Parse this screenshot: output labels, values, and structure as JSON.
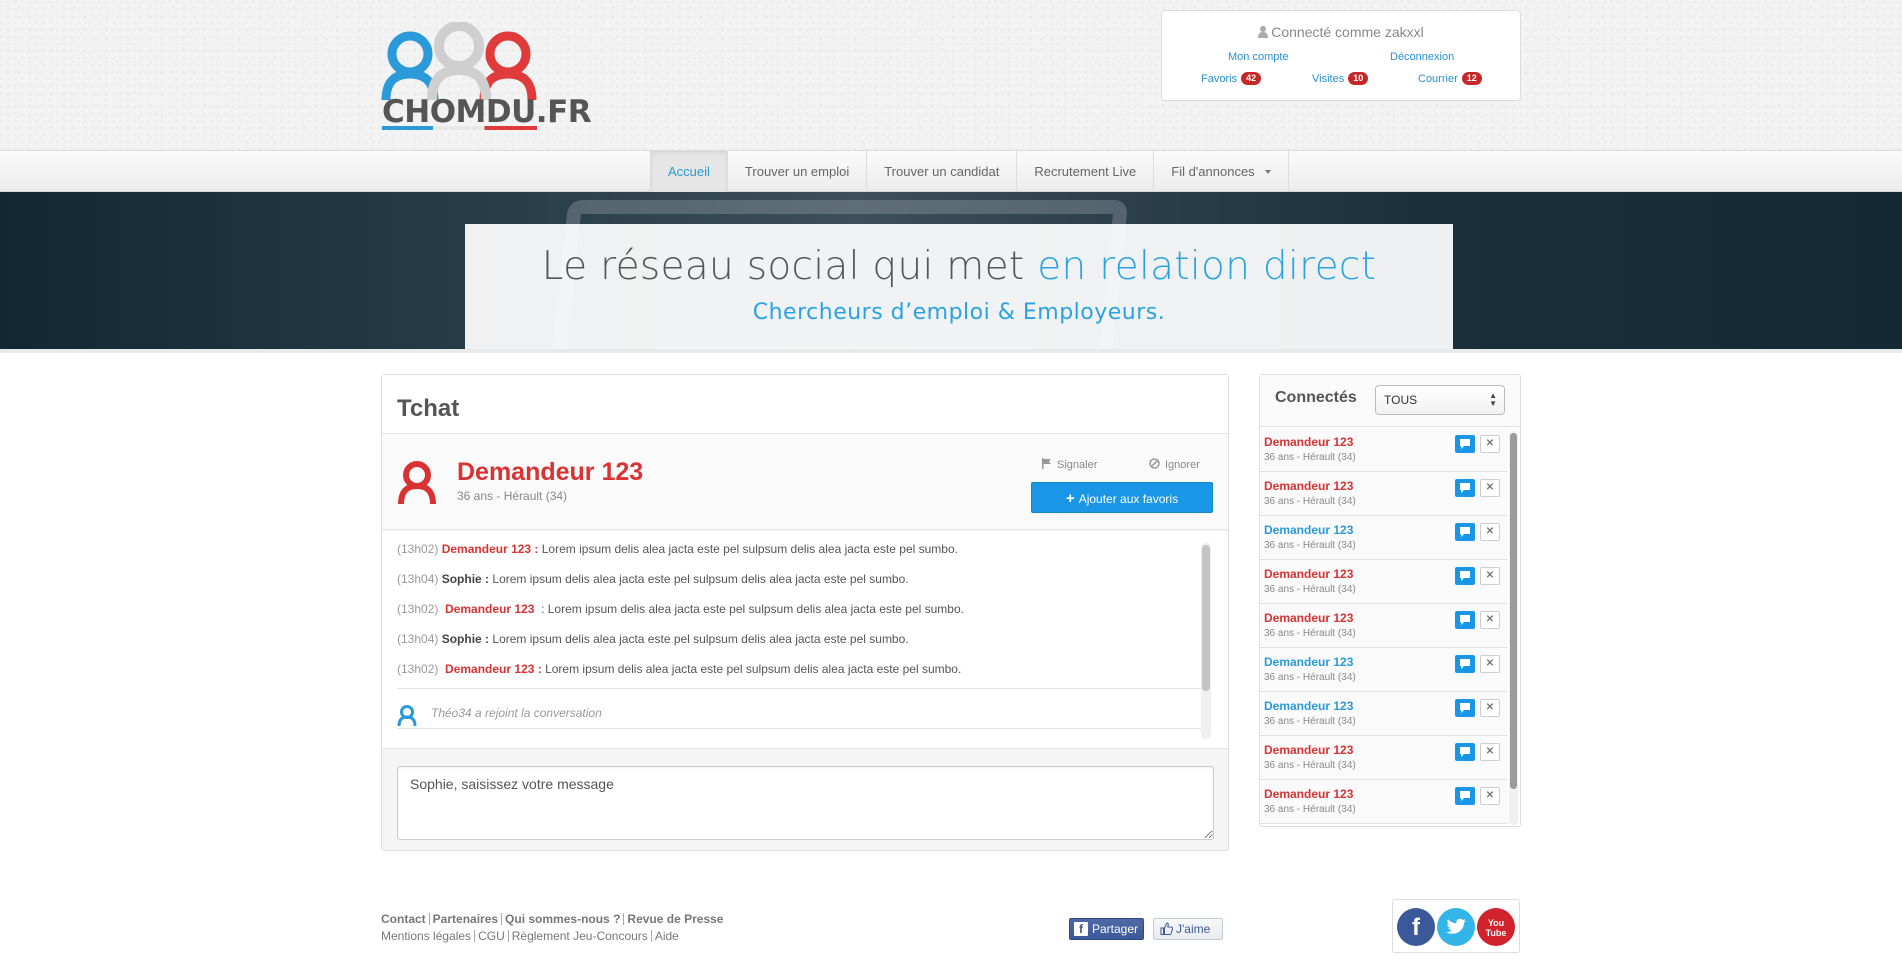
{
  "brand": {
    "logo_text": "CHOMDU.FR",
    "colors": {
      "blue": "#2a9ad8",
      "red": "#d83232",
      "grey": "#cfcfcf"
    }
  },
  "user_box": {
    "connected_label": "Connecté comme zakxxl",
    "user_icon": "user-icon",
    "account_link": "Mon compte",
    "logout_link": "Déconnexion",
    "favorites_label": "Favoris",
    "favorites_count": "42",
    "visits_label": "Visites",
    "visits_count": "10",
    "mail_label": "Courrier",
    "mail_count": "12"
  },
  "nav": {
    "items": [
      {
        "label": "Accueil",
        "active": true
      },
      {
        "label": "Trouver un emploi"
      },
      {
        "label": "Trouver un candidat"
      },
      {
        "label": "Recrutement Live"
      },
      {
        "label": "Fil d'annonces",
        "dropdown": true
      }
    ]
  },
  "hero": {
    "line1_part1": "Le réseau social qui met ",
    "line1_highlight": "en relation direct",
    "line2": "Chercheurs d’emploi & Employeurs."
  },
  "chat": {
    "title": "Tchat",
    "profile": {
      "name": "Demandeur 123",
      "details": "36 ans - Hérault (34)"
    },
    "report_label": "Signaler",
    "ignore_label": "Ignorer",
    "favorite_button": "Ajouter aux favoris",
    "messages": [
      {
        "time": "(13h02)",
        "author": "Demandeur 123 :",
        "text": " Lorem ipsum delis alea jacta este pel sulpsum delis alea jacta este pel sumbo."
      },
      {
        "time": "(13h04)",
        "author": "Sophie :",
        "text": " Lorem ipsum delis alea jacta este pel sulpsum delis alea jacta este pel sumbo."
      },
      {
        "time": "(13h02)",
        "author": "Demandeur 123",
        "text": "  : Lorem ipsum delis alea jacta este pel sulpsum delis alea jacta este pel sumbo."
      },
      {
        "time": "(13h04)",
        "author": "Sophie :",
        "text": " Lorem ipsum delis alea jacta este pel sulpsum delis alea jacta este pel sumbo."
      },
      {
        "time": "(13h02)",
        "author": "Demandeur 123 :",
        "text": " Lorem ipsum delis alea jacta este pel sulpsum delis alea jacta este pel sumbo."
      }
    ],
    "join_notice": "Théo34 a rejoint la conversation",
    "input_placeholder": "Sophie, saisissez votre message"
  },
  "connected": {
    "title": "Connectés",
    "filter_value": "TOUS",
    "users": [
      {
        "name": "Demandeur 123",
        "details": "36 ans - Hérault (34)",
        "color": "red"
      },
      {
        "name": "Demandeur 123",
        "details": "36 ans - Hérault (34)",
        "color": "red"
      },
      {
        "name": "Demandeur 123",
        "details": "36 ans - Hérault (34)",
        "color": "blue"
      },
      {
        "name": "Demandeur 123",
        "details": "36 ans - Hérault (34)",
        "color": "red"
      },
      {
        "name": "Demandeur 123",
        "details": "36 ans - Hérault (34)",
        "color": "red"
      },
      {
        "name": "Demandeur 123",
        "details": "36 ans - Hérault (34)",
        "color": "blue"
      },
      {
        "name": "Demandeur 123",
        "details": "36 ans - Hérault (34)",
        "color": "blue"
      },
      {
        "name": "Demandeur 123",
        "details": "36 ans - Hérault (34)",
        "color": "red"
      },
      {
        "name": "Demandeur 123",
        "details": "36 ans - Hérault (34)",
        "color": "red"
      }
    ]
  },
  "footer": {
    "row1": [
      "Contact",
      "Partenaires",
      "Qui sommes-nous ?",
      "Revue de Presse"
    ],
    "row2": [
      "Mentions légales",
      "CGU",
      "Règlement Jeu-Concours",
      "Aide"
    ],
    "share_label": "Partager",
    "like_label": "J'aime",
    "social": [
      "facebook-icon",
      "twitter-icon",
      "youtube-icon"
    ],
    "youtube_label": "You Tube"
  }
}
